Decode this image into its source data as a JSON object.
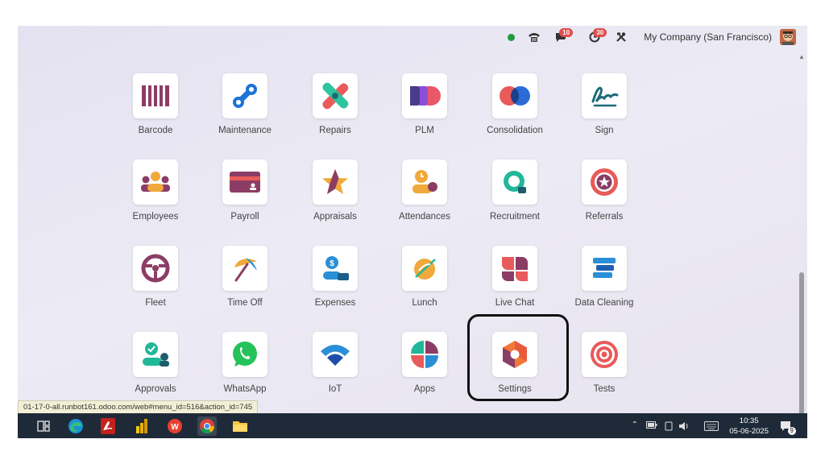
{
  "topbar": {
    "company": "My Company (San Francisco)",
    "messages_count": "10",
    "activities_count": "30",
    "icons": [
      "status-online",
      "phone-icon",
      "chat-icon",
      "clock-icon",
      "tools-icon",
      "avatar"
    ]
  },
  "apps": [
    {
      "label": "Barcode",
      "icon": "barcode-icon"
    },
    {
      "label": "Maintenance",
      "icon": "maintenance-icon"
    },
    {
      "label": "Repairs",
      "icon": "repairs-icon"
    },
    {
      "label": "PLM",
      "icon": "plm-icon"
    },
    {
      "label": "Consolidation",
      "icon": "consolidation-icon"
    },
    {
      "label": "Sign",
      "icon": "sign-icon"
    },
    {
      "label": "Employees",
      "icon": "employees-icon"
    },
    {
      "label": "Payroll",
      "icon": "payroll-icon"
    },
    {
      "label": "Appraisals",
      "icon": "appraisals-icon"
    },
    {
      "label": "Attendances",
      "icon": "attendances-icon"
    },
    {
      "label": "Recruitment",
      "icon": "recruitment-icon"
    },
    {
      "label": "Referrals",
      "icon": "referrals-icon"
    },
    {
      "label": "Fleet",
      "icon": "fleet-icon"
    },
    {
      "label": "Time Off",
      "icon": "time-off-icon"
    },
    {
      "label": "Expenses",
      "icon": "expenses-icon"
    },
    {
      "label": "Lunch",
      "icon": "lunch-icon"
    },
    {
      "label": "Live Chat",
      "icon": "live-chat-icon"
    },
    {
      "label": "Data Cleaning",
      "icon": "data-cleaning-icon"
    },
    {
      "label": "Approvals",
      "icon": "approvals-icon"
    },
    {
      "label": "WhatsApp",
      "icon": "whatsapp-icon"
    },
    {
      "label": "IoT",
      "icon": "iot-icon"
    },
    {
      "label": "Apps",
      "icon": "apps-icon"
    },
    {
      "label": "Settings",
      "icon": "settings-icon"
    },
    {
      "label": "Tests",
      "icon": "tests-icon"
    }
  ],
  "status_url": "01-17-0-all.runbot161.odoo.com/web#menu_id=516&action_id=745",
  "taskbar": {
    "time": "10:35",
    "date": "05-06-2025",
    "notification_count": "9"
  }
}
